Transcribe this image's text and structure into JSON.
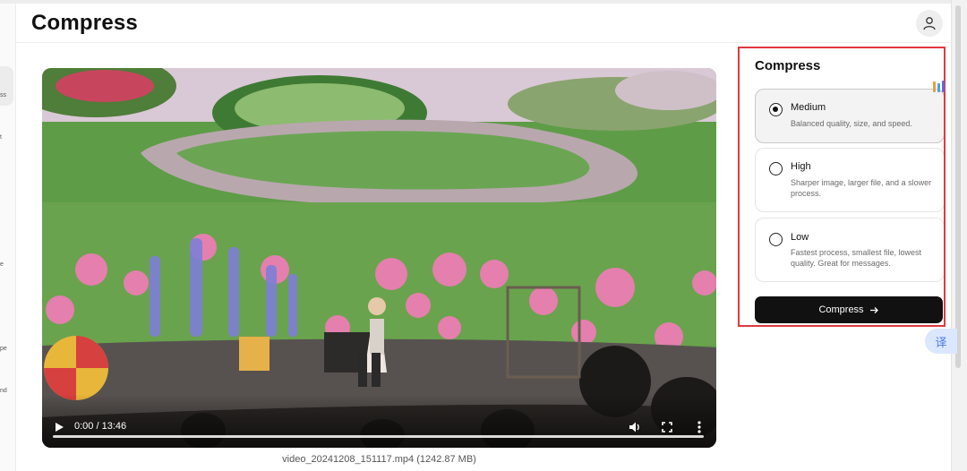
{
  "header": {
    "title": "Compress",
    "avatar_icon": "user-icon"
  },
  "sidebar": {
    "fragments": [
      "ss",
      "t",
      "e",
      "pe",
      "nd"
    ]
  },
  "video": {
    "time": "0:00 / 13:46",
    "progress": 0,
    "filename": "video_20241208_151117.mp4 (1242.87 MB)",
    "play_icon": "play-icon",
    "volume_icon": "volume-icon",
    "fullscreen_icon": "fullscreen-icon",
    "more_icon": "more-vertical-icon"
  },
  "panel": {
    "title": "Compress",
    "options": [
      {
        "name": "Medium",
        "description": "Balanced quality, size, and speed.",
        "selected": true
      },
      {
        "name": "High",
        "description": "Sharper image, larger file, and a slower process.",
        "selected": false
      },
      {
        "name": "Low",
        "description": "Fastest process, smallest file, lowest quality. Great for messages.",
        "selected": false
      }
    ],
    "button_label": "Compress",
    "button_icon": "arrow-right-icon"
  },
  "floating": {
    "translate_label": "译"
  },
  "colors": {
    "highlight": "#e0393f",
    "button_bg": "#111111",
    "selected_option_bg": "#f3f3f3",
    "translate_bg": "#dbe7ff"
  }
}
